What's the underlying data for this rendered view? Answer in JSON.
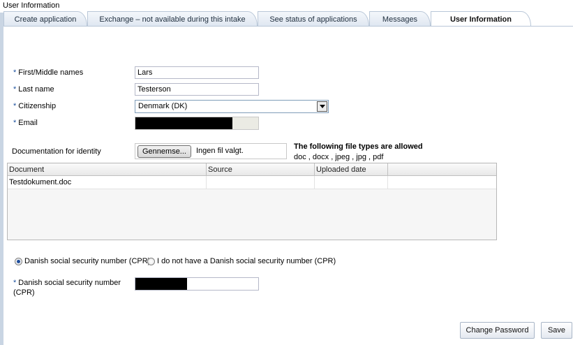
{
  "page": {
    "title": "User Information"
  },
  "tabs": [
    {
      "label": "Create application",
      "active": false
    },
    {
      "label": "Exchange – not available during this intake",
      "active": false
    },
    {
      "label": "See status of applications",
      "active": false
    },
    {
      "label": "Messages",
      "active": false
    },
    {
      "label": "User Information",
      "active": true
    }
  ],
  "form": {
    "required_marker": "*",
    "first_names": {
      "label": "First/Middle names",
      "value": "Lars"
    },
    "last_name": {
      "label": "Last name",
      "value": "Testerson"
    },
    "citizenship": {
      "label": "Citizenship",
      "selected": "Denmark (DK)"
    },
    "email": {
      "label": "Email"
    },
    "documentation": {
      "label": "Documentation for identity",
      "browse_label": "Gennemse...",
      "no_file_text": "Ingen fil valgt.",
      "allowed_title": "The following file types are allowed",
      "allowed_types": "doc , docx , jpeg , jpg , pdf"
    },
    "documents_table": {
      "columns": [
        "Document",
        "Source",
        "Uploaded date",
        ""
      ],
      "rows": [
        [
          "Testdokument.doc",
          "",
          "",
          ""
        ]
      ]
    },
    "cpr_option_yes": {
      "label": "Danish social security number (CPR)",
      "checked": true
    },
    "cpr_option_no": {
      "label": "I do not have a Danish social security number (CPR)",
      "checked": false
    },
    "cpr_field": {
      "label_line1": "Danish social security number",
      "label_line2": "(CPR)"
    }
  },
  "actions": {
    "change_password": "Change Password",
    "save": "Save"
  },
  "colors": {
    "tab_border": "#b9c7d8",
    "required_marker": "#1a4f9c",
    "redaction": "#000000"
  }
}
